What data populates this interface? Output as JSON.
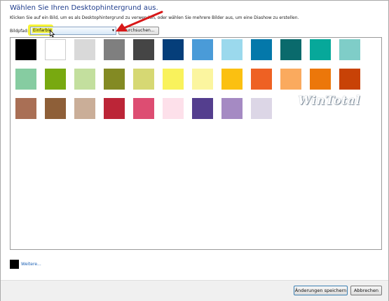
{
  "header": {
    "title": "Wählen Sie Ihren Desktophintergrund aus.",
    "subtitle": "Klicken Sie auf ein Bild, um es als Desktophintergrund zu verwenden, oder wählen Sie mehrere Bilder aus, um eine Diashow zu erstellen."
  },
  "picture_location": {
    "label": "Bildpfad:",
    "selected": "Einfarbig",
    "browse_label": "Durchsuchen..."
  },
  "watermark": "WinTotal",
  "swatches": [
    [
      "#000000",
      "#ffffff",
      "#d9d9d9",
      "#7f7f7f",
      "#454545",
      "#053e7a",
      "#4a9bd8",
      "#9bd9ed",
      "#0478aa",
      "#0a6a6c",
      "#07a89a",
      "#7fcdc8"
    ],
    [
      "#86cca1",
      "#78a910",
      "#c3df9e",
      "#838a23",
      "#d6d873",
      "#f9f25c",
      "#fbf59f",
      "#fbc011",
      "#ee6123",
      "#faaa5e",
      "#ec770a",
      "#c84206"
    ],
    [
      "#a96f55",
      "#8e5f38",
      "#caae98",
      "#bc2537",
      "#dd4d72",
      "#fde0ea",
      "#543e8e",
      "#a58ac3",
      "#dcd6e6"
    ]
  ],
  "more": {
    "label": "Weitere..."
  },
  "footer": {
    "save_label": "Änderungen speichern",
    "cancel_label": "Abbrechen"
  }
}
